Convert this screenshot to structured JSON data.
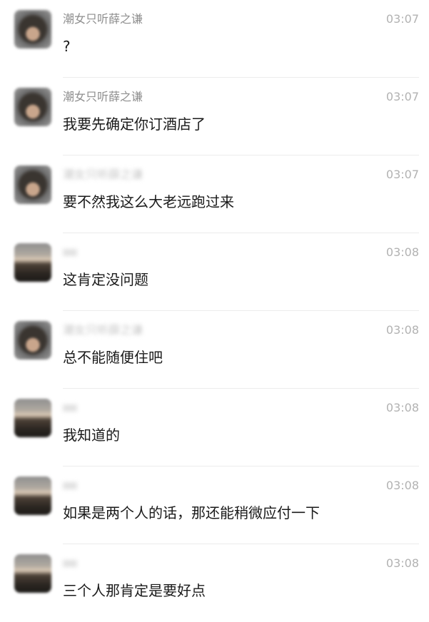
{
  "messages": [
    {
      "sender": "潮女只听薛之谦",
      "time": "03:07",
      "text": "?",
      "avatar": "girl",
      "name_blurred": false
    },
    {
      "sender": "潮女只听薛之谦",
      "time": "03:07",
      "text": "我要先确定你订酒店了",
      "avatar": "girl",
      "name_blurred": false
    },
    {
      "sender": "潮女只听薛之谦",
      "time": "03:07",
      "text": "要不然我这么大老远跑过来",
      "avatar": "girl",
      "name_blurred": true
    },
    {
      "sender": "",
      "time": "03:08",
      "text": "这肯定没问题",
      "avatar": "landscape",
      "name_blurred": true
    },
    {
      "sender": "潮女只听薛之谦",
      "time": "03:08",
      "text": "总不能随便住吧",
      "avatar": "girl",
      "name_blurred": true
    },
    {
      "sender": "",
      "time": "03:08",
      "text": "我知道的",
      "avatar": "landscape",
      "name_blurred": true
    },
    {
      "sender": "",
      "time": "03:08",
      "text": "如果是两个人的话，那还能稍微应付一下",
      "avatar": "landscape",
      "name_blurred": true
    },
    {
      "sender": "",
      "time": "03:08",
      "text": "三个人那肯定是要好点",
      "avatar": "landscape",
      "name_blurred": true
    }
  ]
}
